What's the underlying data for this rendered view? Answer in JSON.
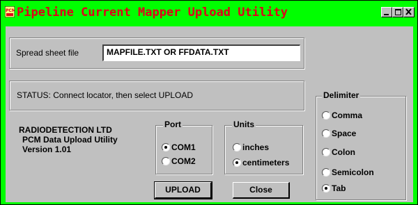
{
  "window": {
    "title": "Pipeline Current Mapper Upload Utility",
    "icon": "pcm-app-icon",
    "controls": [
      "minimize",
      "maximize",
      "close"
    ],
    "colors": {
      "frame": "#00ff00",
      "title_text": "#e0001a",
      "client": "#c0c0c0"
    }
  },
  "file": {
    "label": "Spread sheet file",
    "value": "MAPFILE.TXT OR FFDATA.TXT"
  },
  "status": {
    "text": "STATUS:  Connect locator, then select UPLOAD"
  },
  "about": {
    "company": "RADIODETECTION LTD",
    "product": "PCM Data Upload Utility",
    "version": "Version 1.01"
  },
  "port": {
    "label": "Port",
    "options": [
      "COM1",
      "COM2"
    ],
    "selected": "COM1"
  },
  "units": {
    "label": "Units",
    "options": [
      "inches",
      "centimeters"
    ],
    "selected": "centimeters"
  },
  "delimiter": {
    "label": "Delimiter",
    "options": [
      "Comma",
      "Space",
      "Colon",
      "Semicolon",
      "Tab"
    ],
    "selected": "Tab"
  },
  "buttons": {
    "upload": "UPLOAD",
    "close": "Close"
  }
}
